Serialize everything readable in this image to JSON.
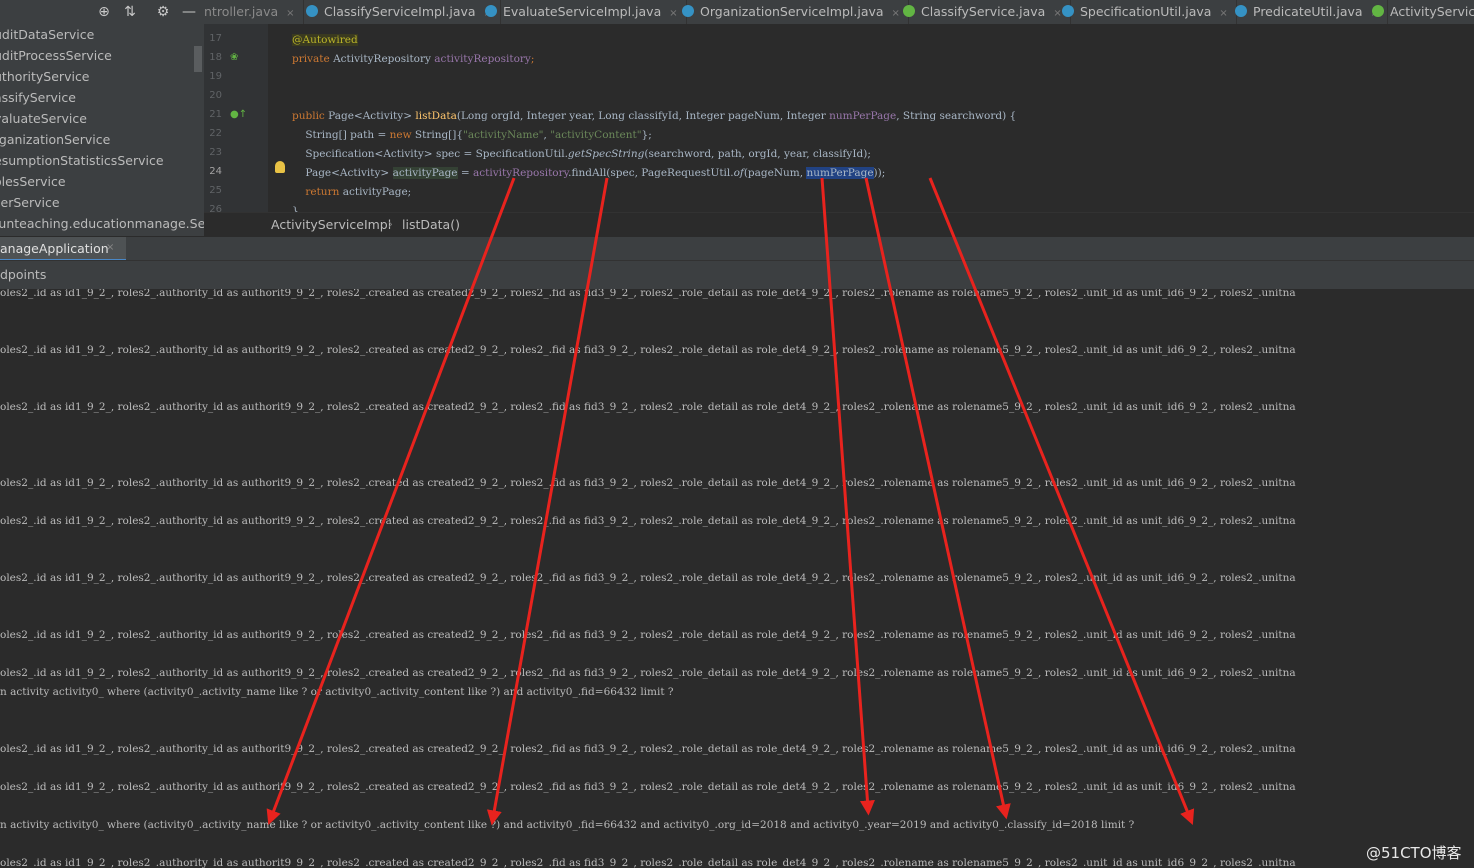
{
  "project": {
    "toolbar_icons": [
      "crosshair-icon",
      "collapse-icon",
      "gear-icon",
      "minimize-icon"
    ],
    "items": [
      "uditDataService",
      "uditProcessService",
      "uthorityService",
      "assifyService",
      "valuateService",
      "rganizationService",
      "esumptionStatisticsService",
      "olesService",
      "serService",
      "funteaching.educationmanage.Servi"
    ]
  },
  "tabs": [
    {
      "label": "ntroller.java",
      "icon": ""
    },
    {
      "label": "ClassifyServiceImpl.java",
      "icon": "c"
    },
    {
      "label": "EvaluateServiceImpl.java",
      "icon": "c"
    },
    {
      "label": "OrganizationServiceImpl.java",
      "icon": "c"
    },
    {
      "label": "ClassifyService.java",
      "icon": "i"
    },
    {
      "label": "SpecificationUtil.java",
      "icon": "c"
    },
    {
      "label": "PredicateUtil.java",
      "icon": "c"
    },
    {
      "label": "ActivityService",
      "icon": "i"
    }
  ],
  "editor": {
    "line_numbers": [
      "17",
      "18",
      "19",
      "20",
      "21",
      "22",
      "23",
      "24",
      "25",
      "26"
    ],
    "lines": [
      {
        "n": "17",
        "parts": [
          {
            "t": "@Autowired",
            "c": "ann"
          }
        ]
      },
      {
        "n": "18",
        "parts": [
          {
            "t": "private ",
            "c": "kw"
          },
          {
            "t": "ActivityRepository ",
            "c": ""
          },
          {
            "t": "activityRepository",
            "c": "fld"
          },
          {
            "t": ";",
            "c": "kw"
          }
        ]
      },
      {
        "n": "19",
        "parts": []
      },
      {
        "n": "20",
        "parts": []
      },
      {
        "n": "21",
        "parts": [
          {
            "t": "public ",
            "c": "kw"
          },
          {
            "t": "Page<Activity> ",
            "c": ""
          },
          {
            "t": "listData",
            "c": "fn"
          },
          {
            "t": "(Long orgId, Integer year, Long classifyId, Integer pageNum, Integer ",
            "c": ""
          },
          {
            "t": "numPerPage",
            "c": "fld"
          },
          {
            "t": ", String searchword) {",
            "c": ""
          }
        ]
      },
      {
        "n": "22",
        "parts": [
          {
            "t": "    String[] path = ",
            "c": ""
          },
          {
            "t": "new ",
            "c": "kw"
          },
          {
            "t": "String[]{",
            "c": ""
          },
          {
            "t": "\"activityName\"",
            "c": "str"
          },
          {
            "t": ", ",
            "c": ""
          },
          {
            "t": "\"activityContent\"",
            "c": "str"
          },
          {
            "t": "};",
            "c": ""
          }
        ]
      },
      {
        "n": "23",
        "parts": [
          {
            "t": "    Specification<Activity> spec = SpecificationUtil.",
            "c": ""
          },
          {
            "t": "getSpecString",
            "c": "ital"
          },
          {
            "t": "(searchword, path, orgId, year, classifyId);",
            "c": ""
          }
        ]
      },
      {
        "n": "24",
        "parts": [
          {
            "t": "    Page<Activity> ",
            "c": ""
          },
          {
            "t": "activityPage",
            "c": "hl"
          },
          {
            "t": " = ",
            "c": ""
          },
          {
            "t": "activityRepository",
            "c": "fld"
          },
          {
            "t": ".findAll(spec, PageRequestUtil.",
            "c": ""
          },
          {
            "t": "of",
            "c": "ital"
          },
          {
            "t": "(pageNum, ",
            "c": ""
          },
          {
            "t": "numPerPage",
            "c": "sel"
          },
          {
            "t": "));",
            "c": ""
          }
        ]
      },
      {
        "n": "25",
        "parts": [
          {
            "t": "    ",
            "c": ""
          },
          {
            "t": "return ",
            "c": "kw"
          },
          {
            "t": "activityPage;",
            "c": ""
          }
        ]
      },
      {
        "n": "26",
        "parts": [
          {
            "t": "}",
            "c": ""
          }
        ]
      }
    ]
  },
  "breadcrumb": {
    "class": "ActivityServiceImpl",
    "separator": "›",
    "method": "listData()"
  },
  "run": {
    "tab_label": "anageApplication",
    "close": "×",
    "subtab": "dpoints"
  },
  "console": {
    "sql_row": "oles2_.id as id1_9_2_, roles2_.authority_id as authorit9_9_2_, roles2_.created as created2_9_2_, roles2_.fid as fid3_9_2_, roles2_.role_detail as role_det4_9_2_, roles2_.rolename as rolename5_9_2_, roles2_.unit_id as unit_id6_9_2_, roles2_.unitna",
    "sql_row_top": "oles2_.id as id1_9_2_, roles2_.authority_id as authorit9_9_2_, roles2_.created as created2_9_2_, roles2_.fid as fid3_9_2_, roles2_.role_detail as role_det4_9_2_, roles2_.rolename as rolename5_9_2_, roles2_.unit_id as unit_id6_9_2_, roles2_.unitna",
    "where_1": "n activity activity0_ where (activity0_.activity_name like ? or activity0_.activity_content like ?) and activity0_.fid=66432 limit ?",
    "where_2": "n activity activity0_ where (activity0_.activity_name like ? or activity0_.activity_content like ?) and activity0_.fid=66432 and activity0_.org_id=2018 and activity0_.year=2019 and activity0_.classify_id=2018 limit ?"
  },
  "watermark": "@51CTO博客",
  "colors": {
    "arrow": "#e8231e",
    "selection": "#214283",
    "accent": "#4a88c7"
  }
}
